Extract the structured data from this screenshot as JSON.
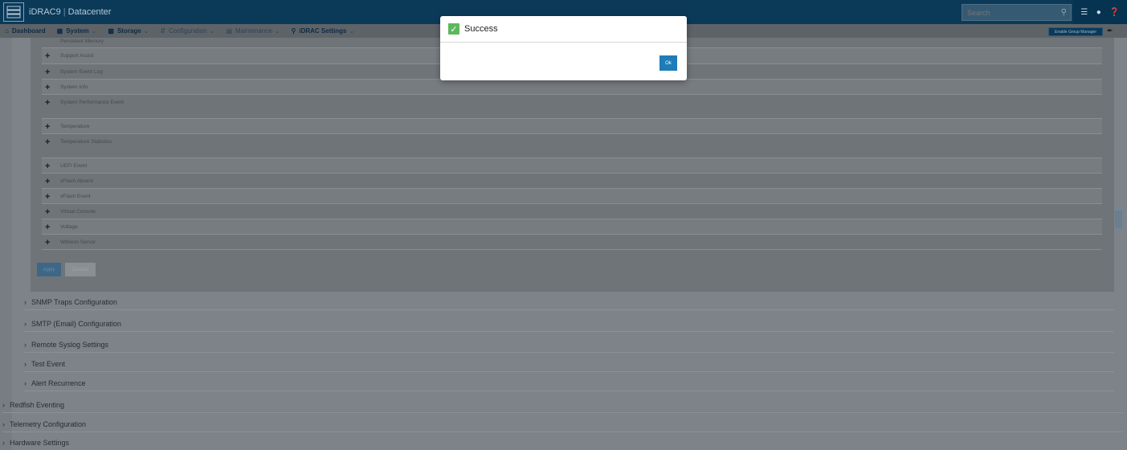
{
  "topbar": {
    "brand": "iDRAC9",
    "context": "Datacenter",
    "search_placeholder": "Search"
  },
  "nav": {
    "items": [
      {
        "label": "Dashboard",
        "icon": "home-icon"
      },
      {
        "label": "System",
        "icon": "server-icon"
      },
      {
        "label": "Storage",
        "icon": "storage-icon"
      },
      {
        "label": "Configuration",
        "icon": "config-icon"
      },
      {
        "label": "Maintenance",
        "icon": "maintenance-icon"
      },
      {
        "label": "iDRAC Settings",
        "icon": "settings-icon"
      }
    ],
    "group_manager_button": "Enable Group Manager"
  },
  "event_rows": [
    {
      "label": "Persistent Memory"
    },
    {
      "label": "Support Assist"
    },
    {
      "label": "System Event Log"
    },
    {
      "label": "System Info"
    },
    {
      "label": "System Performance Event"
    },
    {
      "label": "Temperature"
    },
    {
      "label": "Temperature Statistics"
    },
    {
      "label": "UEFI Event"
    },
    {
      "label": "vFlash Absent"
    },
    {
      "label": "vFlash Event"
    },
    {
      "label": "Virtual Console"
    },
    {
      "label": "Voltage"
    },
    {
      "label": "Witness Server"
    }
  ],
  "buttons": {
    "apply": "Apply",
    "discard": "Discard"
  },
  "sections": [
    {
      "label": "SNMP Traps Configuration"
    },
    {
      "label": "SMTP (Email) Configuration"
    },
    {
      "label": "Remote Syslog Settings"
    },
    {
      "label": "Test Event"
    },
    {
      "label": "Alert Recurrence"
    },
    {
      "label": "Redfish Eventing"
    },
    {
      "label": "Telemetry Configuration"
    },
    {
      "label": "Hardware Settings"
    }
  ],
  "modal": {
    "title": "Success",
    "ok_label": "Ok"
  }
}
